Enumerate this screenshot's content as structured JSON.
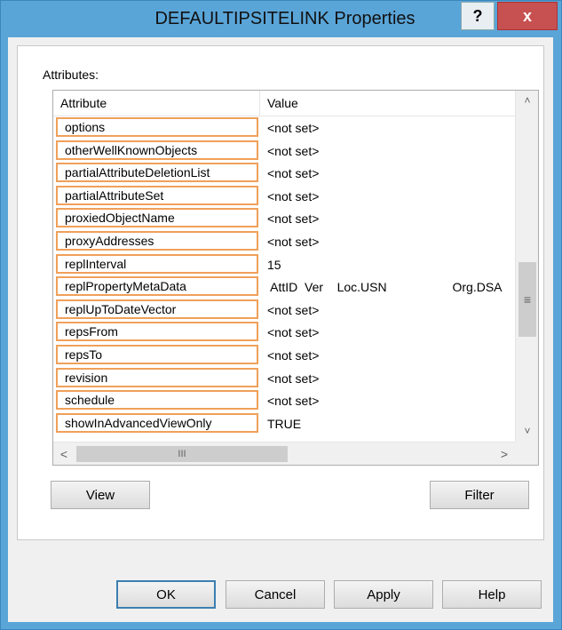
{
  "window": {
    "title": "DEFAULTIPSITELINK Properties",
    "help_label": "?",
    "close_label": "x"
  },
  "attributes_label": "Attributes:",
  "columns": [
    "Attribute",
    "Value"
  ],
  "rows": [
    {
      "attribute": "options",
      "value": "<not set>"
    },
    {
      "attribute": "otherWellKnownObjects",
      "value": "<not set>"
    },
    {
      "attribute": "partialAttributeDeletionList",
      "value": "<not set>"
    },
    {
      "attribute": "partialAttributeSet",
      "value": "<not set>"
    },
    {
      "attribute": "proxiedObjectName",
      "value": "<not set>"
    },
    {
      "attribute": "proxyAddresses",
      "value": "<not set>"
    },
    {
      "attribute": "replInterval",
      "value": "15"
    },
    {
      "attribute": "replPropertyMetaData",
      "value": " AttID  Ver    Loc.USN                   Org.DSA"
    },
    {
      "attribute": "replUpToDateVector",
      "value": "<not set>"
    },
    {
      "attribute": "repsFrom",
      "value": "<not set>"
    },
    {
      "attribute": "repsTo",
      "value": "<not set>"
    },
    {
      "attribute": "revision",
      "value": "<not set>"
    },
    {
      "attribute": "schedule",
      "value": "<not set>"
    },
    {
      "attribute": "showInAdvancedViewOnly",
      "value": "TRUE"
    }
  ],
  "scrollbars": {
    "up_glyph": "˄",
    "down_glyph": "˅",
    "left_glyph": "<",
    "right_glyph": ">",
    "thumb_grip": "≡",
    "hthumb_grip": "III"
  },
  "buttons": {
    "view": "View",
    "filter": "Filter",
    "ok": "OK",
    "cancel": "Cancel",
    "apply": "Apply",
    "help": "Help"
  },
  "colors": {
    "highlight_border": "#f0a05a",
    "title_bar": "#5aa5d8",
    "close_button": "#c75050"
  }
}
